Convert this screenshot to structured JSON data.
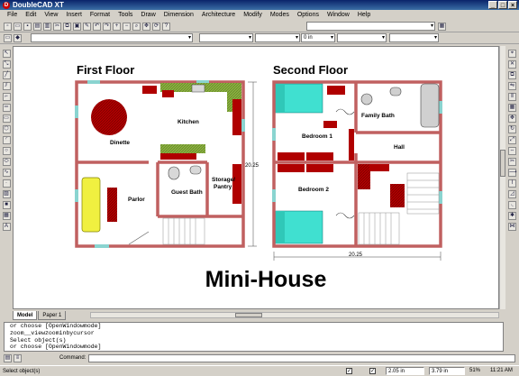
{
  "app": {
    "title": "DoubleCAD XT",
    "logo_letter": "D"
  },
  "menu": [
    "File",
    "Edit",
    "View",
    "Insert",
    "Format",
    "Tools",
    "Draw",
    "Dimension",
    "Architecture",
    "Modify",
    "Modes",
    "Options",
    "Window",
    "Help"
  ],
  "toolbar2": {
    "units_value": "0 in"
  },
  "drawing": {
    "first_floor_title": "First Floor",
    "second_floor_title": "Second Floor",
    "main_title": "Mini-House",
    "rooms": {
      "kitchen": "Kitchen",
      "dinette": "Dinette",
      "parlor": "Parlor",
      "guest_bath": "Guest Bath",
      "storage_line1": "Storage/",
      "storage_line2": "Pantry",
      "bedroom1": "Bedroom 1",
      "bedroom2": "Bedroom 2",
      "family_bath": "Family Bath",
      "hall": "Hall"
    },
    "dim_vertical": "20.25",
    "dim_horizontal": "20.25"
  },
  "tabs": {
    "model": "Model",
    "paper": "Paper 1"
  },
  "command_history": [
    "or choose [OpenWindowmode]",
    "zoom__viewzoominbycursor",
    "Select object(s)",
    "or choose [OpenWindowmode]"
  ],
  "command_label": "Command:",
  "status": {
    "prompt": "Select object(s)",
    "x_value": "2.05 in",
    "y_value": "3.79 in",
    "zoom": "51%",
    "time": "11:21 AM"
  },
  "colors": {
    "wall": "#e8a8a8",
    "furniture_red": "#b00000",
    "counter_green": "#8ab040",
    "bed_cyan": "#40e0d0",
    "sofa_yellow": "#f0f040"
  }
}
